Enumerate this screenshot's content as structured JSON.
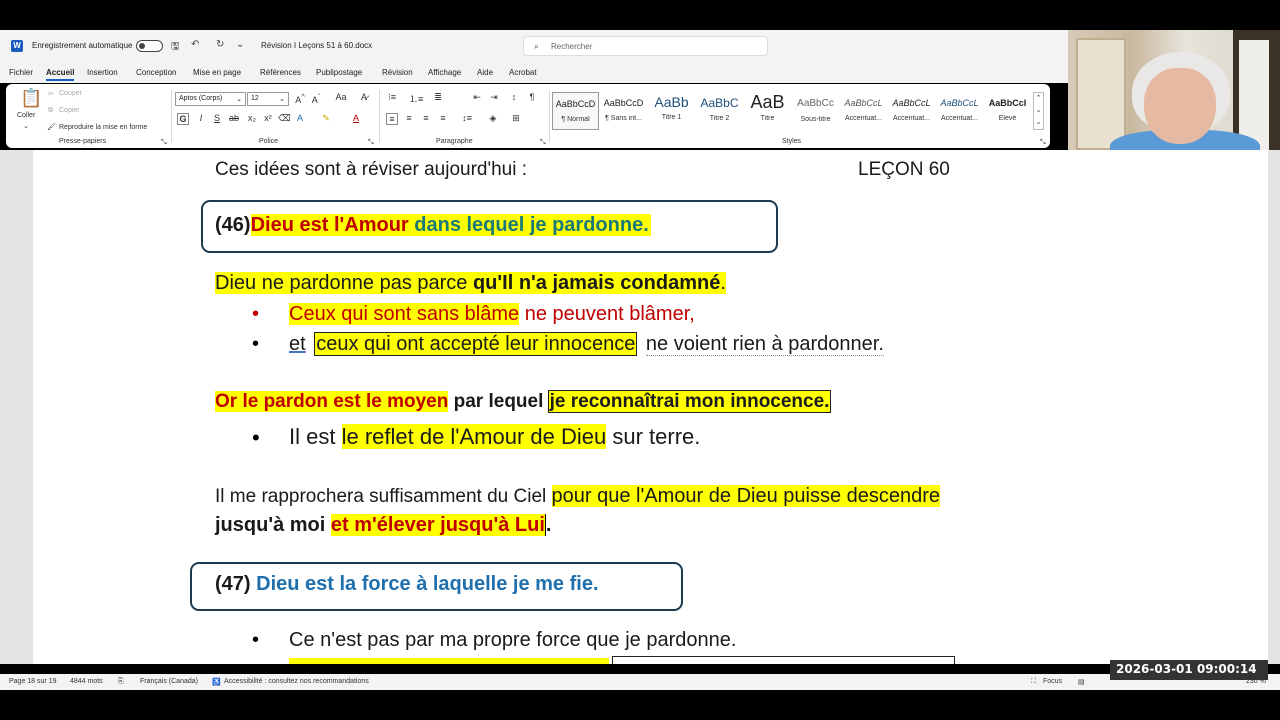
{
  "titlebar": {
    "autosave_label": "Enregistrement automatique",
    "doc_name": "Révision I Leçons 51 à 60.docx",
    "search_placeholder": "Rechercher"
  },
  "menu_tabs": [
    "Fichier",
    "Accueil",
    "Insertion",
    "Conception",
    "Mise en page",
    "Références",
    "Publipostage",
    "Révision",
    "Affichage",
    "Aide",
    "Acrobat"
  ],
  "active_tab": "Accueil",
  "ribbon": {
    "clipboard": {
      "paste": "Coller",
      "cut": "Couper",
      "copy": "Copier",
      "format_painter": "Reproduire la mise en forme",
      "group": "Presse-papiers"
    },
    "font": {
      "name": "Aptos (Corps)",
      "size": "12",
      "group": "Police"
    },
    "paragraph": {
      "group": "Paragraphe"
    },
    "styles": {
      "group": "Styles",
      "items": [
        {
          "preview": "AaBbCcD",
          "name": "¶ Normal"
        },
        {
          "preview": "AaBbCcD",
          "name": "¶ Sans int..."
        },
        {
          "preview": "AaBb",
          "name": "Titre 1"
        },
        {
          "preview": "AaBbC",
          "name": "Titre 2"
        },
        {
          "preview": "AaB",
          "name": "Titre"
        },
        {
          "preview": "AaBbCc",
          "name": "Sous-titre"
        },
        {
          "preview": "AaBbCcL",
          "name": "Accentuat..."
        },
        {
          "preview": "AaBbCcL",
          "name": "Accentuat..."
        },
        {
          "preview": "AaBbCcL",
          "name": "Accentuat..."
        },
        {
          "preview": "AaBbCcI",
          "name": "Élevé"
        }
      ]
    }
  },
  "document": {
    "heading_left": "Ces idées sont à réviser aujourd'hui :",
    "heading_right": "LEÇON 60",
    "box46": {
      "num": "(46)",
      "part1": "Dieu est l'Amour",
      "part2": " dans lequel je pardonne."
    },
    "line1": {
      "a": "Dieu ne pardonne pas parce ",
      "b": "qu'Il n'a jamais condamné",
      "c": "."
    },
    "bullet1": {
      "a": "Ceux qui sont sans blâme",
      "b": " ne peuvent blâmer,"
    },
    "bullet2": {
      "a": "et",
      "b": "ceux qui ont accepté leur innocence",
      "c": "ne voient rien à pardonner."
    },
    "line2": {
      "a": "Or le pardon est le moyen",
      "b": " par lequel ",
      "c": "je reconnaîtrai mon innocence."
    },
    "bullet3": {
      "a": "Il est ",
      "b": "le reflet de l'Amour de Dieu",
      "c": " sur terre."
    },
    "line3": {
      "a": " Il me rapprochera suffisamment du Ciel ",
      "b": "pour que l'Amour de Dieu puisse descendre"
    },
    "line4": {
      "a": "jusqu'à moi ",
      "b": "et m'élever jusqu'à Lui",
      "c": "."
    },
    "box47": {
      "num": "(47)",
      "text": "Dieu est la force à laquelle je me fie."
    },
    "bullet4": "Ce n'est pas par ma propre force que je pardonne."
  },
  "statusbar": {
    "page": "Page 18 sur 19",
    "words": "4844 mots",
    "language": "Français (Canada)",
    "accessibility": "Accessibilité : consultez nos recommandations",
    "focus": "Focus",
    "zoom": "230 %"
  },
  "timestamp": "2026-03-01  09:00:14"
}
